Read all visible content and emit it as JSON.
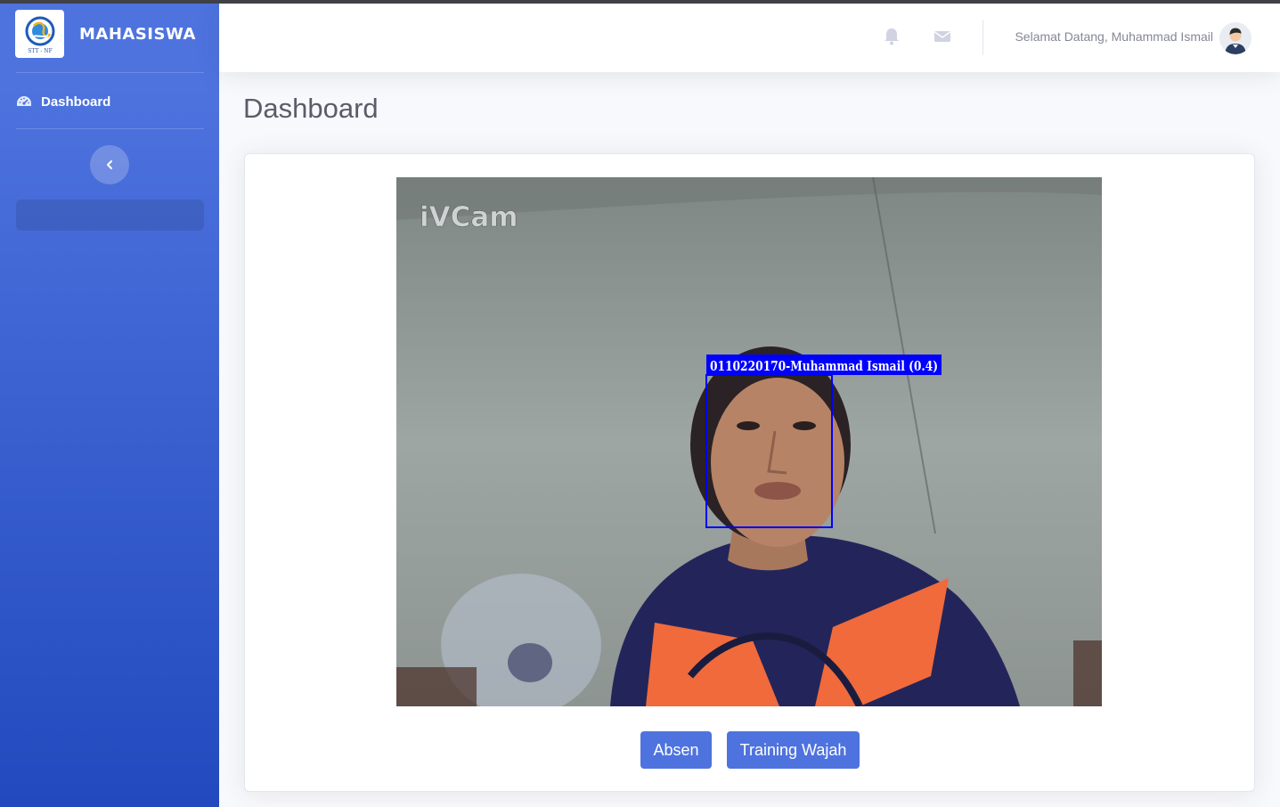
{
  "app": {
    "brand": "MAHASISWA",
    "logo_text": "STT - NF"
  },
  "sidebar": {
    "items": [
      {
        "label": "Dashboard",
        "icon": "tachometer-icon"
      }
    ],
    "toggle_icon": "chevron-left-icon"
  },
  "topbar": {
    "welcome": "Selamat Datang, Muhammad Ismail",
    "icons": [
      "bell-icon",
      "envelope-icon"
    ]
  },
  "page": {
    "title": "Dashboard"
  },
  "camera": {
    "watermark": "iVCam",
    "detection_label": "0110220170-Muhammad Ismail (0.4)"
  },
  "actions": {
    "absen": "Absen",
    "training": "Training Wajah"
  },
  "colors": {
    "primary": "#4e73df",
    "sidebar_bottom": "#224abe",
    "detection_box": "#0000ff"
  }
}
